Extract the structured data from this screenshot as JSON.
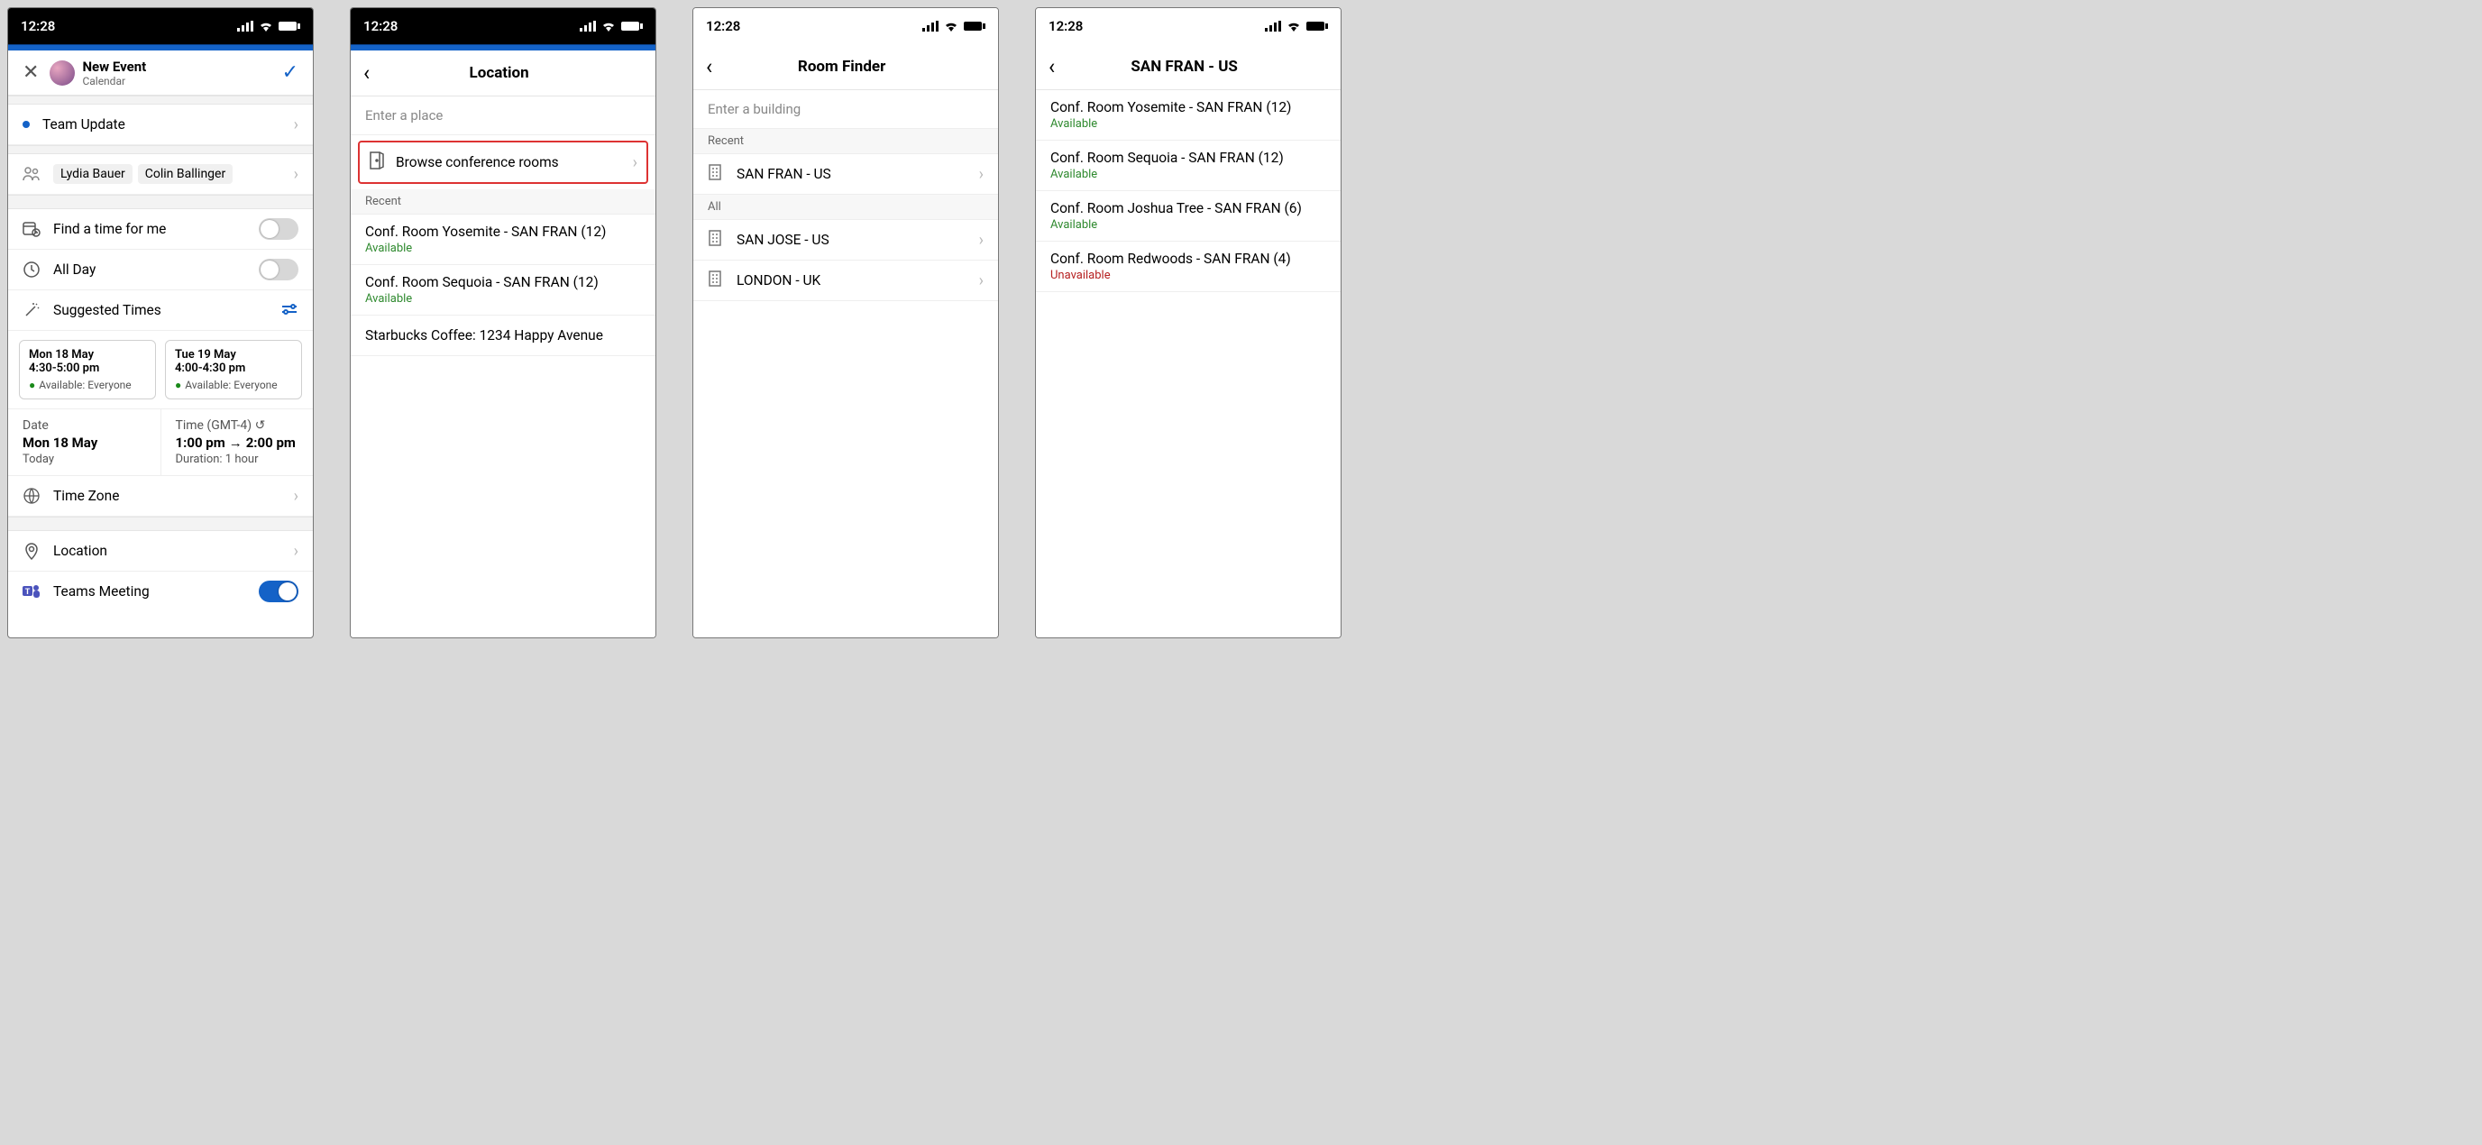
{
  "shared": {
    "clock": "12:28"
  },
  "screen1": {
    "header": {
      "title": "New Event",
      "subtitle": "Calendar"
    },
    "event_title": "Team Update",
    "attendees": [
      "Lydia Bauer",
      "Colin Ballinger"
    ],
    "find_time": "Find a time for me",
    "all_day": "All Day",
    "suggested_label": "Suggested Times",
    "suggestions": [
      {
        "date": "Mon 18 May",
        "time": "4:30-5:00 pm",
        "avail": "Available: Everyone"
      },
      {
        "date": "Tue 19 May",
        "time": "4:00-4:30 pm",
        "avail": "Available: Everyone"
      }
    ],
    "date_block": {
      "label": "Date",
      "value": "Mon 18 May",
      "sub": "Today"
    },
    "time_block": {
      "label": "Time (GMT-4)",
      "from": "1:00 pm",
      "to": "2:00 pm",
      "duration": "Duration: 1 hour"
    },
    "timezone": "Time Zone",
    "location": "Location",
    "teams_meeting": "Teams Meeting"
  },
  "screen2": {
    "title": "Location",
    "placeholder": "Enter a place",
    "browse": "Browse conference rooms",
    "recent_label": "Recent",
    "recent": [
      {
        "name": "Conf. Room Yosemite - SAN FRAN (12)",
        "status": "Available"
      },
      {
        "name": "Conf. Room Sequoia - SAN FRAN (12)",
        "status": "Available"
      },
      {
        "name": "Starbucks Coffee: 1234 Happy Avenue"
      }
    ]
  },
  "screen3": {
    "title": "Room Finder",
    "placeholder": "Enter a building",
    "recent_label": "Recent",
    "recent": [
      "SAN FRAN - US"
    ],
    "all_label": "All",
    "all": [
      "SAN JOSE - US",
      "LONDON - UK"
    ]
  },
  "screen4": {
    "title": "SAN FRAN - US",
    "rooms": [
      {
        "name": "Conf. Room Yosemite - SAN FRAN (12)",
        "status": "Available",
        "avail": true
      },
      {
        "name": "Conf. Room Sequoia - SAN FRAN (12)",
        "status": "Available",
        "avail": true
      },
      {
        "name": "Conf. Room Joshua Tree - SAN FRAN (6)",
        "status": "Available",
        "avail": true
      },
      {
        "name": "Conf. Room Redwoods - SAN FRAN (4)",
        "status": "Unavailable",
        "avail": false
      }
    ]
  }
}
